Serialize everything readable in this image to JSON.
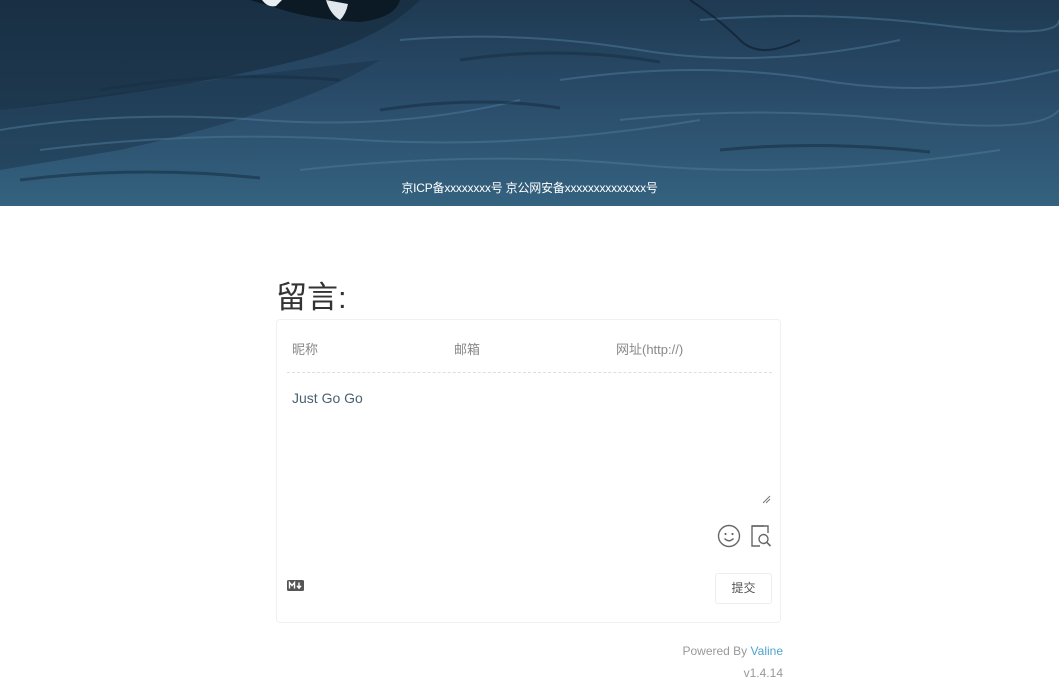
{
  "hero": {
    "beian_text": "京ICP备xxxxxxxx号 京公网安备xxxxxxxxxxxxxx号"
  },
  "comments": {
    "title": "留言:",
    "fields": {
      "nick_placeholder": "昵称",
      "mail_placeholder": "邮箱",
      "link_placeholder": "网址(http://)"
    },
    "editor_placeholder": "Just Go Go",
    "icons": {
      "emoji": "smile-face-icon",
      "preview": "preview-search-icon",
      "markdown": "markdown-icon"
    },
    "submit_label": "提交",
    "powered_prefix": "Powered By ",
    "powered_link": "Valine",
    "version": "v1.4.14"
  }
}
